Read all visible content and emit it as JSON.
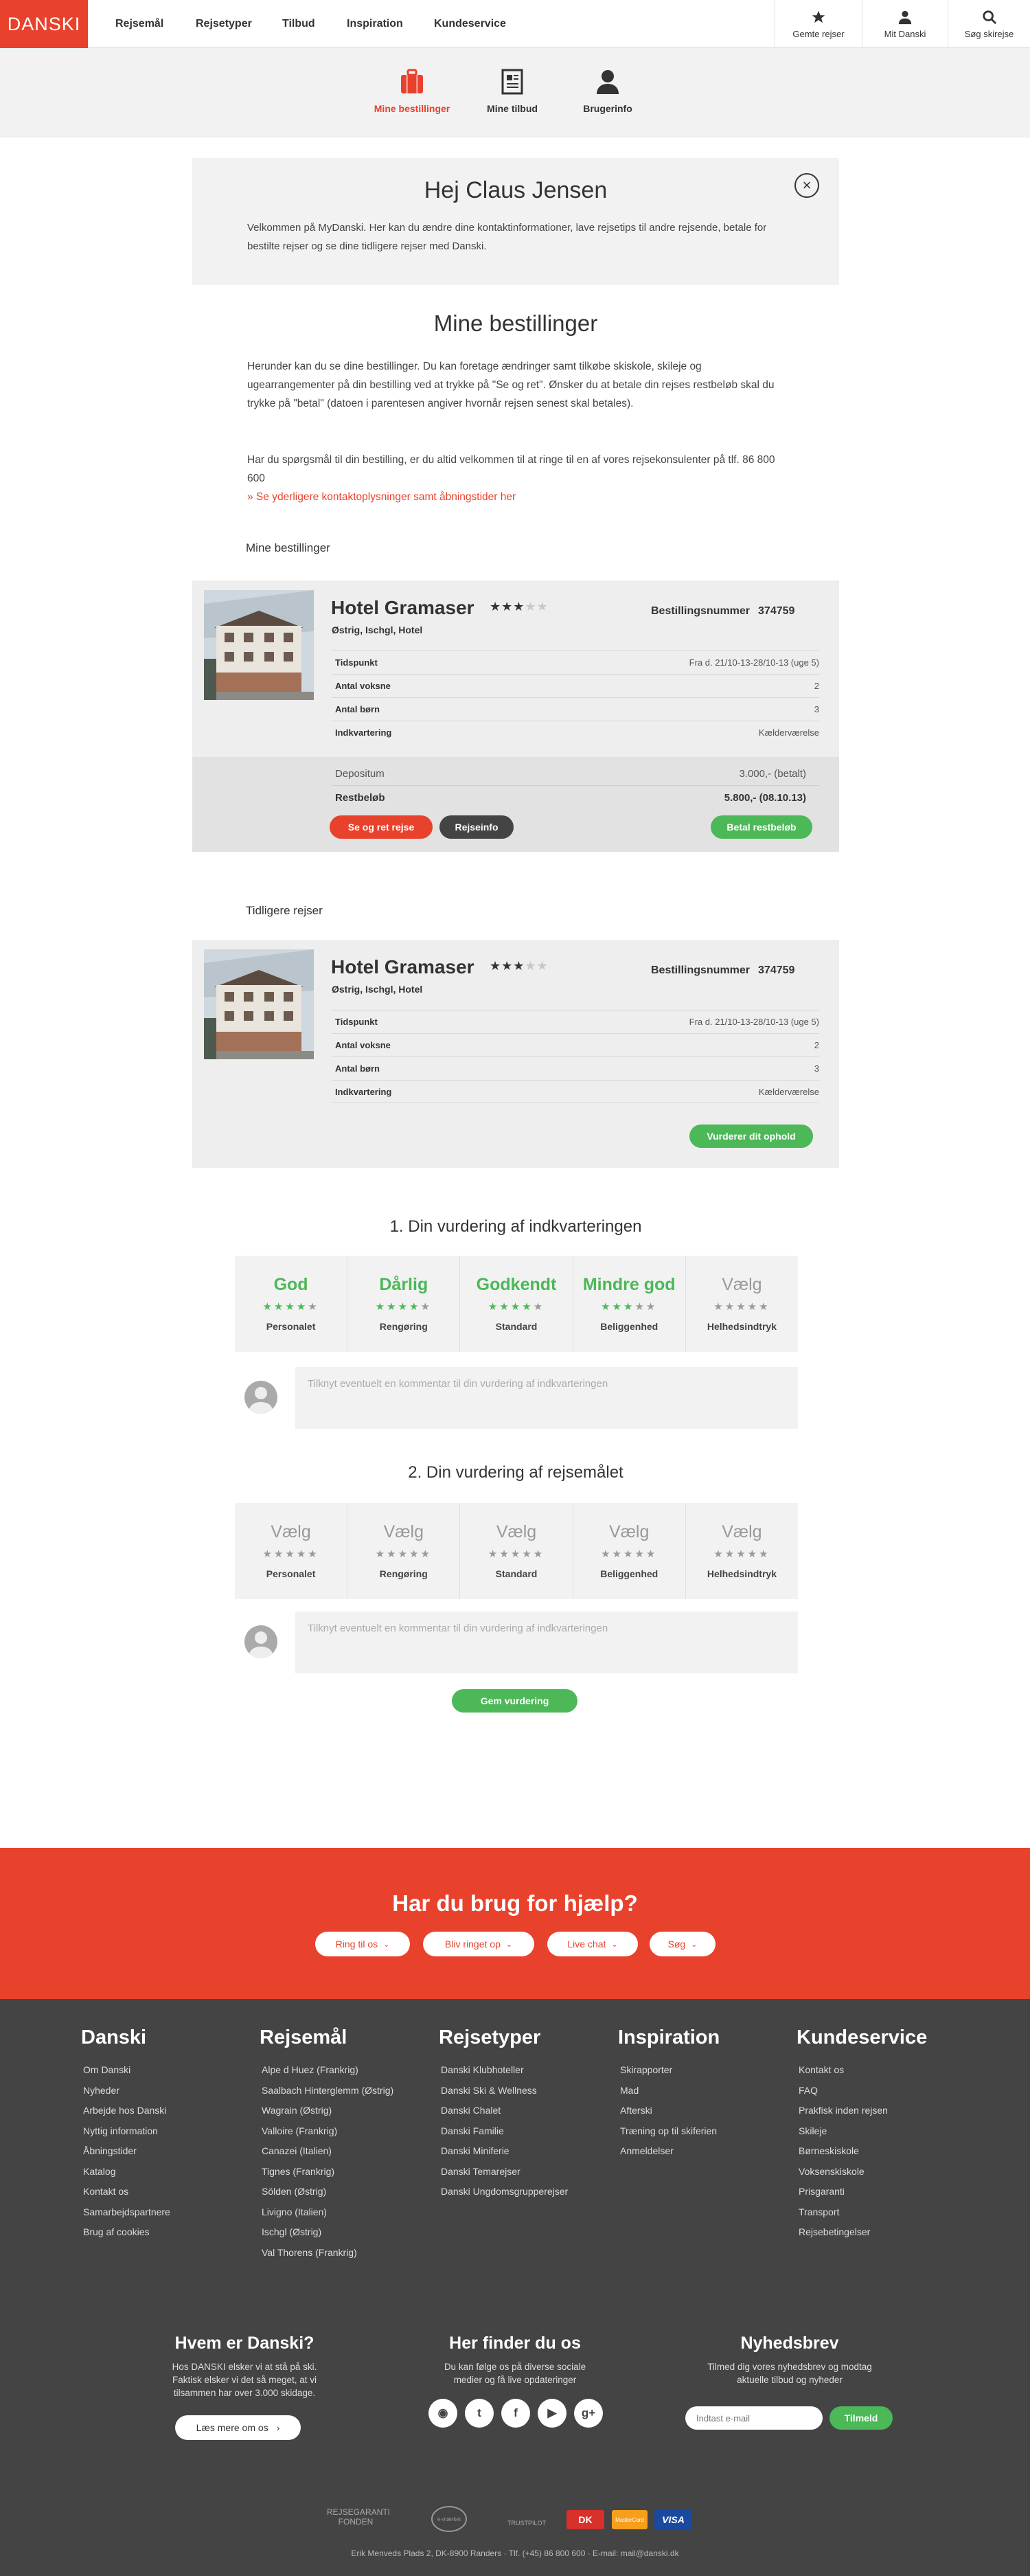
{
  "header": {
    "logo": "DANSKI",
    "nav": [
      "Rejsemål",
      "Rejsetyper",
      "Tilbud",
      "Inspiration",
      "Kundeservice"
    ],
    "actions": {
      "saved": "Gemte rejser",
      "account": "Mit Danski",
      "search": "Søg skirejse"
    }
  },
  "subnav": {
    "tabs": [
      {
        "label": "Mine bestillinger",
        "icon": "suitcase-icon",
        "active": true
      },
      {
        "label": "Mine tilbud",
        "icon": "document-icon",
        "active": false
      },
      {
        "label": "Brugerinfo",
        "icon": "user-icon",
        "active": false
      }
    ]
  },
  "welcome": {
    "title": "Hej Claus Jensen",
    "text": "Velkommen på MyDanski. Her kan du ændre dine kontaktinformationer, lave rejsetips til andre rejsende, betale for bestilte rejser og se dine tidligere rejser med Danski."
  },
  "bookings": {
    "title": "Mine bestillinger",
    "intro1": "Herunder kan du se dine bestillinger. Du kan foretage ændringer samt tilkøbe skiskole, skileje og ugearrangementer på din bestilling ved at trykke på \"Se og ret\". Ønsker du at betale din rejses restbeløb skal du trykke på \"betal\" (datoen i parentesen angiver hvornår rejsen senest skal betales).",
    "intro2": "Har du spørgsmål til din bestilling, er du altid velkommen til at ringe til en af vores rejsekonsulenter på tlf. 86 800 600",
    "contact_link": "» Se yderligere kontaktoplysninger samt åbningstider her",
    "section_label": "Mine bestillinger",
    "previous_label": "Tidligere rejser"
  },
  "current_booking": {
    "hotel": "Hotel Gramaser",
    "stars": "★★★",
    "stars_empty": "★★",
    "location": "Østrig, Ischgl, Hotel",
    "booking_label": "Bestillingsnummer",
    "booking_no": "374759",
    "rows": [
      {
        "k": "Tidspunkt",
        "v": "Fra d. 21/10-13-28/10-13 (uge 5)"
      },
      {
        "k": "Antal voksne",
        "v": "2"
      },
      {
        "k": "Antal børn",
        "v": "3"
      },
      {
        "k": "Indkvartering",
        "v": "Kælderværelse"
      }
    ],
    "deposit_label": "Depositum",
    "deposit_value": "3.000,- (betalt)",
    "rest_label": "Restbeløb",
    "rest_value": "5.800,- (08.10.13)",
    "btn_edit": "Se og ret rejse",
    "btn_info": "Rejseinfo",
    "btn_pay": "Betal restbeløb"
  },
  "previous_booking": {
    "hotel": "Hotel Gramaser",
    "stars": "★★★",
    "stars_empty": "★★",
    "location": "Østrig, Ischgl, Hotel",
    "booking_label": "Bestillingsnummer",
    "booking_no": "374759",
    "rows": [
      {
        "k": "Tidspunkt",
        "v": "Fra d. 21/10-13-28/10-13 (uge 5)"
      },
      {
        "k": "Antal voksne",
        "v": "2"
      },
      {
        "k": "Antal børn",
        "v": "3"
      },
      {
        "k": "Indkvartering",
        "v": "Kælderværelse"
      }
    ],
    "btn_rate": "Vurderer dit ophold"
  },
  "rating1": {
    "title": "1. Din vurdering af indkvarteringen",
    "cells": [
      {
        "value": "God",
        "label": "Personalet",
        "stars": 4
      },
      {
        "value": "Dårlig",
        "label": "Rengøring",
        "stars": 4
      },
      {
        "value": "Godkendt",
        "label": "Standard",
        "stars": 4
      },
      {
        "value": "Mindre god",
        "label": "Beliggenhed",
        "stars": 3
      },
      {
        "value": "Vælg",
        "label": "Helhedsindtryk",
        "stars": 0
      }
    ],
    "comment_placeholder": "Tilknyt eventuelt en kommentar til din vurdering af indkvarteringen"
  },
  "rating2": {
    "title": "2. Din vurdering af rejsemålet",
    "cells": [
      {
        "value": "Vælg",
        "label": "Personalet",
        "stars": 0
      },
      {
        "value": "Vælg",
        "label": "Rengøring",
        "stars": 0
      },
      {
        "value": "Vælg",
        "label": "Standard",
        "stars": 0
      },
      {
        "value": "Vælg",
        "label": "Beliggenhed",
        "stars": 0
      },
      {
        "value": "Vælg",
        "label": "Helhedsindtryk",
        "stars": 0
      }
    ],
    "comment_placeholder": "Tilknyt eventuelt en kommentar til din vurdering af indkvarteringen"
  },
  "save_btn": "Gem vurdering",
  "help": {
    "title": "Har du brug for hjælp?",
    "buttons": [
      "Ring til os",
      "Bliv ringet op",
      "Live chat",
      "Søg"
    ]
  },
  "footer": {
    "cols": [
      {
        "title": "Danski",
        "items": [
          "Om Danski",
          "Nyheder",
          "Arbejde hos Danski",
          "Nyttig information",
          "Åbningstider",
          "Katalog",
          "Kontakt os",
          "Samarbejdspartnere",
          "Brug af cookies"
        ]
      },
      {
        "title": "Rejsemål",
        "items": [
          "Alpe d Huez (Frankrig)",
          "Saalbach Hinterglemm (Østrig)",
          "Wagrain (Østrig)",
          "Valloire (Frankrig)",
          "Canazei (Italien)",
          "Tignes (Frankrig)",
          "Sölden (Østrig)",
          "Livigno (Italien)",
          "Ischgl (Østrig)",
          "Val Thorens (Frankrig)"
        ]
      },
      {
        "title": "Rejsetyper",
        "items": [
          "Danski Klubhoteller",
          "Danski Ski & Wellness",
          "Danski Chalet",
          "Danski Familie",
          "Danski Miniferie",
          "Danski Temarejser",
          "Danski Ungdomsgrupperejser"
        ]
      },
      {
        "title": "Inspiration",
        "items": [
          "Skirapporter",
          "Mad",
          "Afterski",
          "Træning op til skiferien",
          "Anmeldelser"
        ]
      },
      {
        "title": "Kundeservice",
        "items": [
          "Kontakt os",
          "FAQ",
          "Prakfisk inden rejsen",
          "Skileje",
          "Børneskiskole",
          "Voksenskiskole",
          "Prisgaranti",
          "Transport",
          "Rejsebetingelser"
        ]
      }
    ],
    "about_title": "Hvem er Danski?",
    "about_text": "Hos DANSKI elsker vi at stå på ski. Faktisk elsker vi det så meget, at vi tilsammen har over 3.000 skidage.",
    "about_btn": "Læs mere om os",
    "social_title": "Her finder du os",
    "social_text": "Du kan følge os på diverse sociale medier og få live opdateringer",
    "social_icons": [
      "rss-icon",
      "twitter-icon",
      "facebook-icon",
      "youtube-icon",
      "googleplus-icon"
    ],
    "news_title": "Nyhedsbrev",
    "news_text": "Tilmed dig vores nyhedsbrev og modtag aktuelle tilbud og nyheder",
    "news_placeholder": "Indtast e-mail",
    "news_btn": "Tilmeld",
    "partners": [
      "REJSEGARANTI FONDEN",
      "e-mærket",
      "TRUSTPILOT",
      "DK",
      "MasterCard",
      "VISA"
    ],
    "address": "Erik Menveds Plads 2, DK-8900 Randers · Tlf. (+45) 86 800 600  ·  E-mail: mail@danski.dk"
  },
  "colors": {
    "brand_red": "#e8412c",
    "green": "#4cb857",
    "footer_bg": "#444444"
  }
}
